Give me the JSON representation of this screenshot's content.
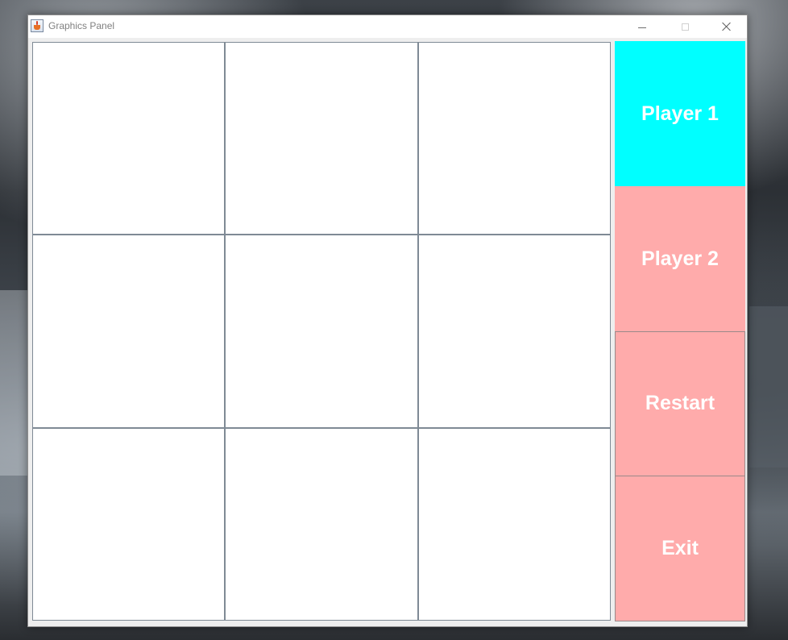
{
  "window": {
    "title": "Graphics Panel",
    "app_icon": "java-cup-icon",
    "controls": {
      "minimize_icon": "minimize-icon",
      "maximize_icon": "maximize-icon",
      "close_icon": "close-icon"
    }
  },
  "board": {
    "rows": 3,
    "cols": 3,
    "cells": [
      "",
      "",
      "",
      "",
      "",
      "",
      "",
      "",
      ""
    ],
    "grid_line_color": "#7f8a95",
    "cell_color": "#ffffff"
  },
  "side_panel": {
    "buttons": [
      {
        "id": "player1",
        "label": "Player 1",
        "color": "#00ffff"
      },
      {
        "id": "player2",
        "label": "Player 2",
        "color": "#ffabab"
      },
      {
        "id": "restart",
        "label": "Restart",
        "color": "#ffabab"
      },
      {
        "id": "exit",
        "label": "Exit",
        "color": "#ffabab"
      }
    ]
  }
}
